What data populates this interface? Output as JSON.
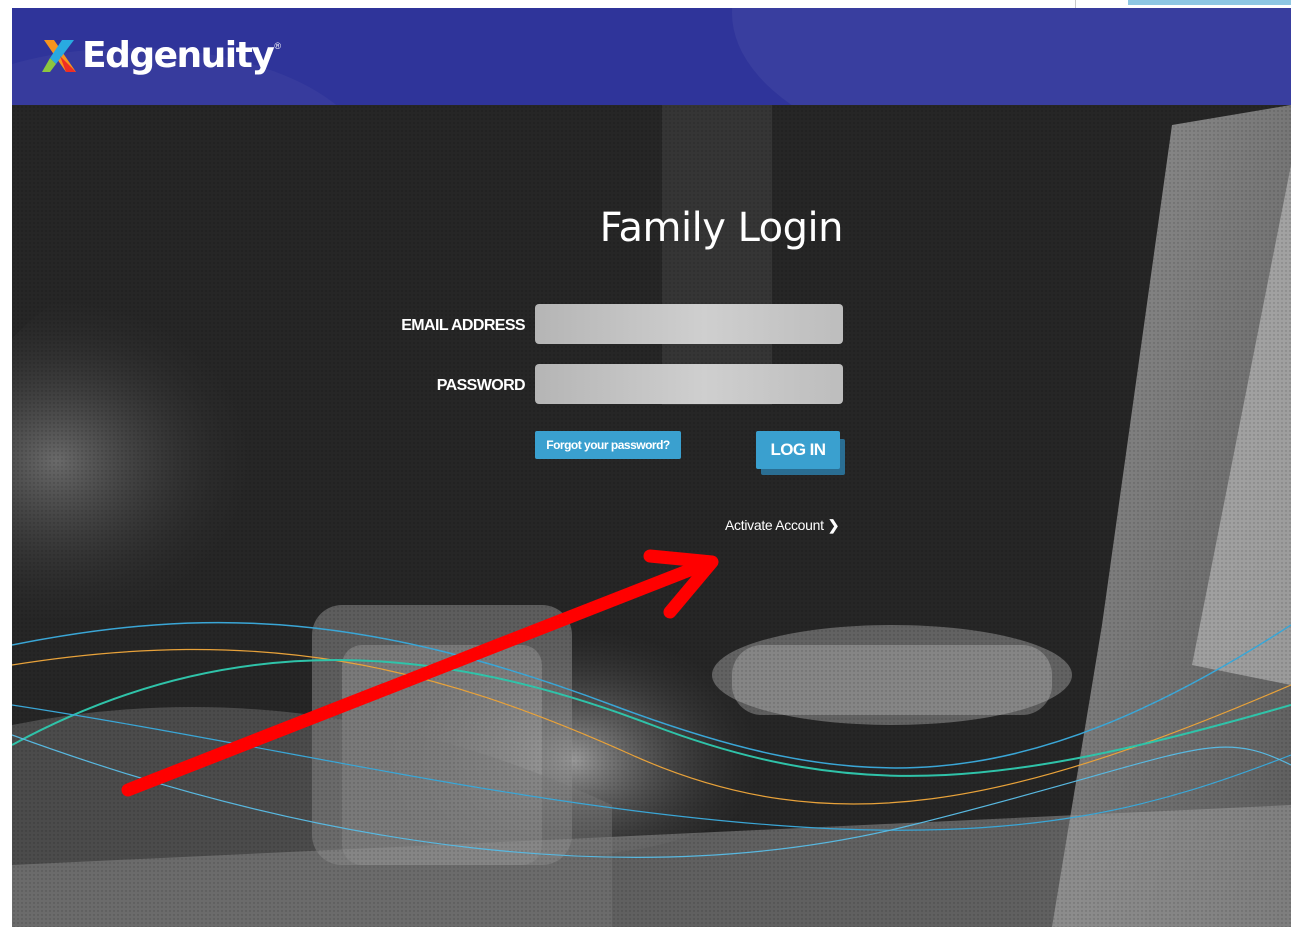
{
  "brand": {
    "name": "Edgenuity",
    "registered_mark": "®",
    "header_color": "#2f349a",
    "logo_colors": [
      "#f7941d",
      "#29aae1",
      "#8dc63f",
      "#ed1c24"
    ]
  },
  "page": {
    "title": "Family Login"
  },
  "form": {
    "email_label": "EMAIL ADDRESS",
    "email_value": "",
    "password_label": "PASSWORD",
    "password_value": "",
    "forgot_label": "Forgot your password?",
    "login_label": "LOG IN",
    "activate_label": "Activate Account",
    "activate_icon": "chevron-right-icon",
    "button_color": "#3aa0cf"
  },
  "annotation": {
    "arrow_color": "#ff0000",
    "points_to": "Activate Account"
  }
}
